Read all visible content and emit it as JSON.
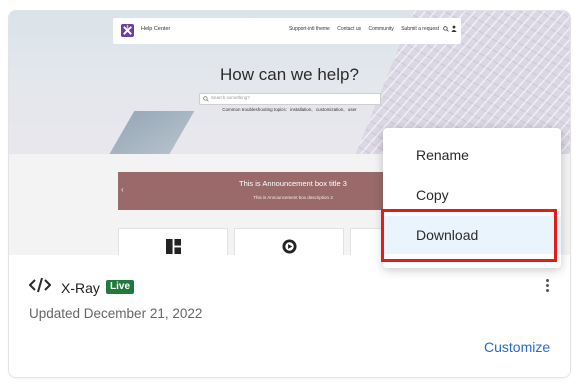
{
  "preview": {
    "topbar": {
      "site_name": "Help Center",
      "nav": [
        "Support-intl theme",
        "Contact us",
        "Community",
        "Submit a request"
      ]
    },
    "hero": {
      "title": "How can we help?",
      "search_placeholder": "Search something?",
      "popular": [
        "Common troubleshooting topics:",
        "installation,",
        "customization,",
        "user"
      ]
    },
    "announcement": {
      "title": "This is Announcement box title 3",
      "subtitle": "This is Announcement box description 3"
    }
  },
  "card": {
    "app_name": "X-Ray",
    "badge": "Live",
    "updated": "Updated December 21, 2022",
    "customize_label": "Customize",
    "icons": {
      "code": "code-icon",
      "more": "more-vertical-icon"
    }
  },
  "menu": {
    "items": [
      {
        "label": "Rename"
      },
      {
        "label": "Copy"
      },
      {
        "label": "Download"
      }
    ],
    "highlighted": "Download"
  },
  "colors": {
    "badge_bg": "#1f7a3b",
    "link": "#2a6bc9",
    "announcement_bg": "#9a6a6a",
    "highlight_border": "#e21b1b",
    "menu_hover": "#e9f4fc"
  }
}
